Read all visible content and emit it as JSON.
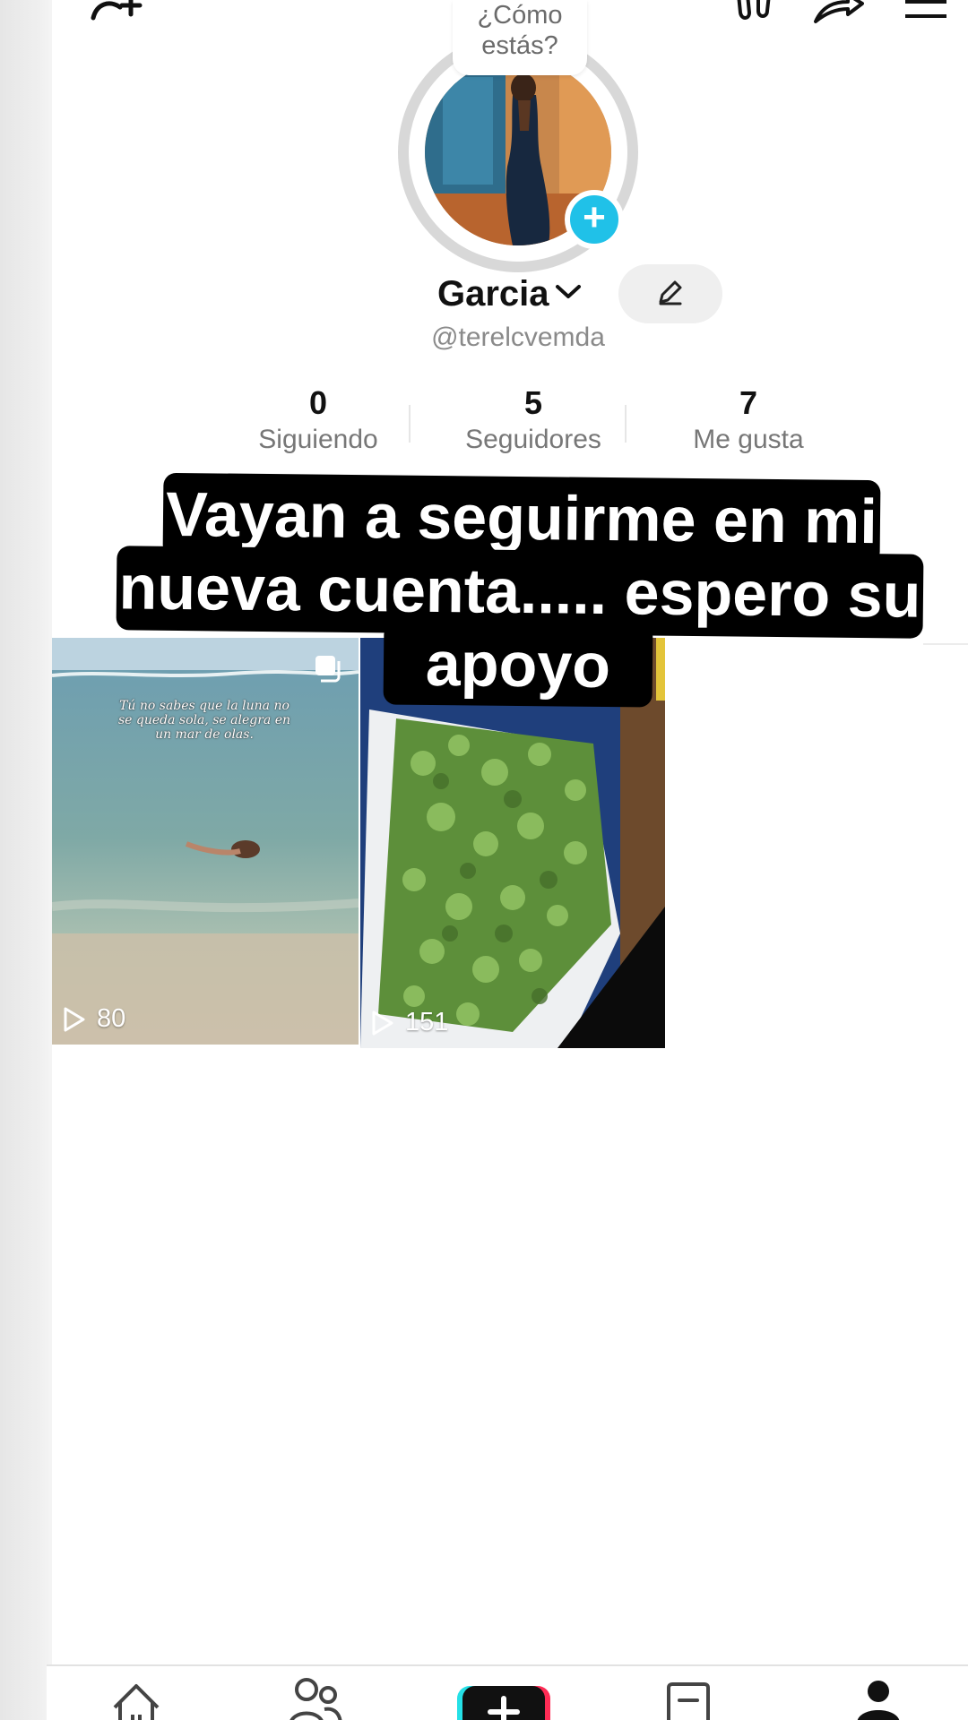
{
  "profile": {
    "status_line1": "¿Cómo",
    "status_line2": "estás?",
    "display_name": "Garcia",
    "handle": "@terelcvemda"
  },
  "stats": [
    {
      "value": "0",
      "label": "Siguiendo"
    },
    {
      "value": "5",
      "label": "Seguidores"
    },
    {
      "value": "7",
      "label": "Me gusta"
    }
  ],
  "caption": {
    "line1": "Vayan a seguirme en mi",
    "line2": "nueva cuenta..... espero su",
    "line3": "apoyo"
  },
  "videos": [
    {
      "views": "80",
      "overlay_text": "Tú no sabes que la luna no se queda sola, se alegra en un mar de olas."
    },
    {
      "views": "151"
    }
  ],
  "nav": {
    "items": [
      "home-icon",
      "friends-icon",
      "create-icon",
      "inbox-icon",
      "profile-icon"
    ]
  },
  "colors": {
    "accent": "#20c1e8",
    "caption_bg": "#000000"
  }
}
